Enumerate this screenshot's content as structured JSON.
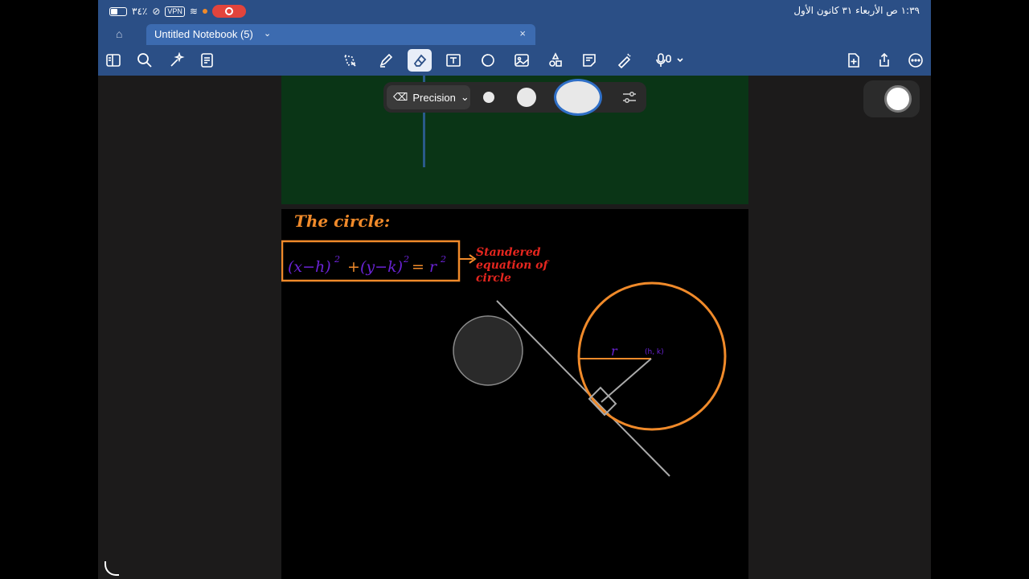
{
  "status": {
    "time_date": "١:٣٩ ص  الأربعاء ٣١ كانون الأول",
    "battery": "٣٤٪",
    "vpn": "VPN"
  },
  "tab": {
    "title": "Untitled Notebook (5)"
  },
  "pen_menu": {
    "mode": "Precision"
  },
  "note": {
    "heading": "The circle:",
    "equation_side_label": "Standered equation of circle",
    "radius_label": "r",
    "center_label": "(h, k)"
  },
  "colors": {
    "header": "#2b4f86",
    "orange": "#f08a2a",
    "red": "#e5261f",
    "purple": "#6a23d4"
  },
  "icons": [
    "sidebar-icon",
    "search-icon",
    "sparkle-icon",
    "notes-icon",
    "lasso-icon",
    "pen-icon",
    "eraser-icon",
    "text-box-icon",
    "shapes-icon",
    "image-icon",
    "stickers-icon",
    "sticky-note-icon",
    "highlighter-icon",
    "microphone-icon",
    "add-page-icon",
    "share-icon",
    "more-icon"
  ]
}
